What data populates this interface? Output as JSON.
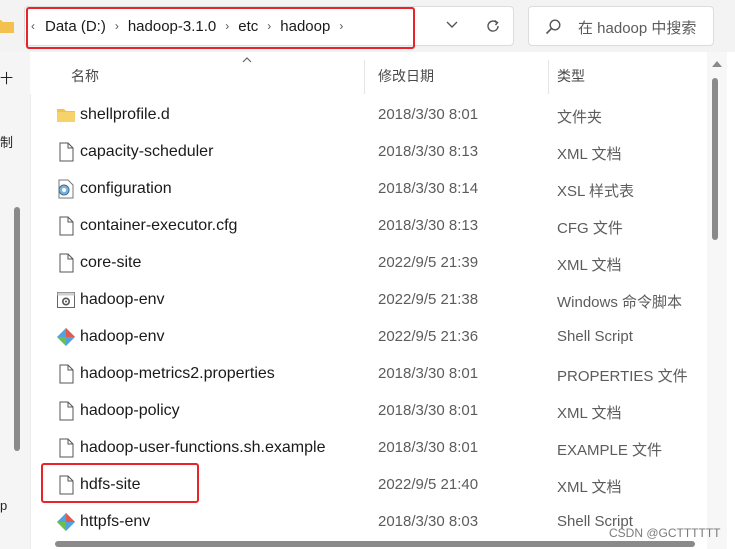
{
  "address_bar": {
    "crumbs": [
      "Data (D:)",
      "hadoop-3.1.0",
      "etc",
      "hadoop"
    ]
  },
  "search": {
    "placeholder": "在 hadoop 中搜索"
  },
  "nav_fragments": [
    "十",
    "制",
    "p"
  ],
  "columns": {
    "name": "名称",
    "date": "修改日期",
    "type": "类型"
  },
  "files": [
    {
      "name": "shellprofile.d",
      "date": "2018/3/30 8:01",
      "type": "文件夹",
      "icon": "folder-icon"
    },
    {
      "name": "capacity-scheduler",
      "date": "2018/3/30 8:13",
      "type": "XML 文档",
      "icon": "document-icon"
    },
    {
      "name": "configuration",
      "date": "2018/3/30 8:14",
      "type": "XSL 样式表",
      "icon": "xsl-stylesheet-icon"
    },
    {
      "name": "container-executor.cfg",
      "date": "2018/3/30 8:13",
      "type": "CFG 文件",
      "icon": "document-icon"
    },
    {
      "name": "core-site",
      "date": "2022/9/5 21:39",
      "type": "XML 文档",
      "icon": "document-icon"
    },
    {
      "name": "hadoop-env",
      "date": "2022/9/5 21:38",
      "type": "Windows 命令脚本",
      "icon": "batch-script-icon"
    },
    {
      "name": "hadoop-env",
      "date": "2022/9/5 21:36",
      "type": "Shell Script",
      "icon": "shell-script-icon"
    },
    {
      "name": "hadoop-metrics2.properties",
      "date": "2018/3/30 8:01",
      "type": "PROPERTIES 文件",
      "icon": "document-icon"
    },
    {
      "name": "hadoop-policy",
      "date": "2018/3/30 8:01",
      "type": "XML 文档",
      "icon": "document-icon"
    },
    {
      "name": "hadoop-user-functions.sh.example",
      "date": "2018/3/30 8:01",
      "type": "EXAMPLE 文件",
      "icon": "document-icon"
    },
    {
      "name": "hdfs-site",
      "date": "2022/9/5 21:40",
      "type": "XML 文档",
      "icon": "document-icon"
    },
    {
      "name": "httpfs-env",
      "date": "2018/3/30 8:03",
      "type": "Shell Script",
      "icon": "shell-script-icon"
    }
  ],
  "watermark": "CSDN @GCTTTTTT",
  "colors": {
    "highlight": "#e8232a",
    "folder": "#f2c14e",
    "shell_icon": "#4fa3e0"
  }
}
